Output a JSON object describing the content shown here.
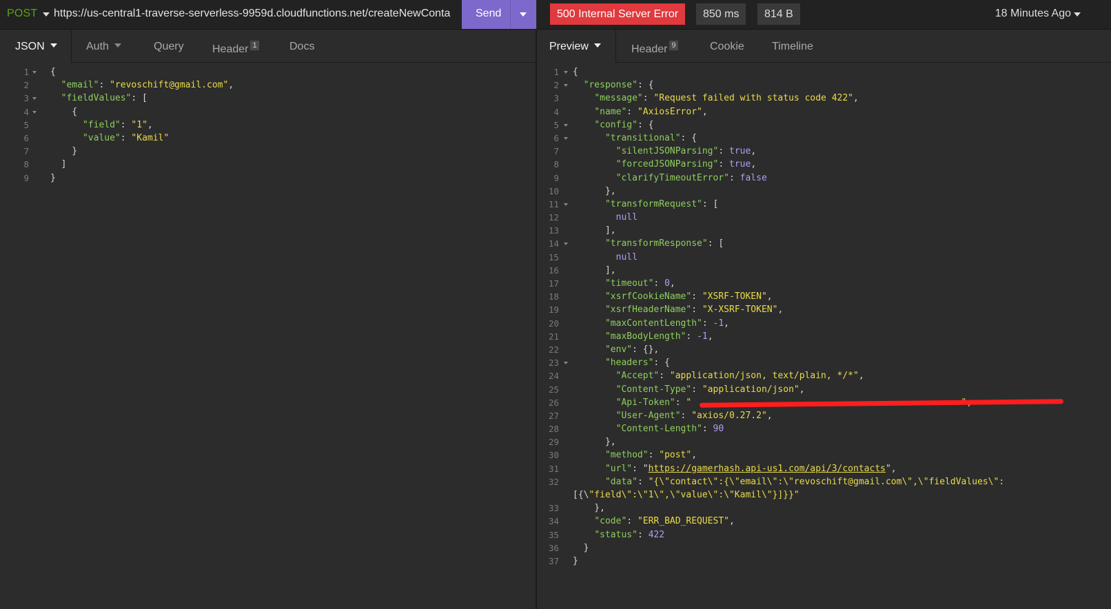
{
  "request": {
    "method": "POST",
    "url": "https://us-central1-traverse-serverless-9959d.cloudfunctions.net/createNewConta",
    "send_label": "Send"
  },
  "response_status": {
    "status": "500 Internal Server Error",
    "time": "850 ms",
    "size": "814 B",
    "ago": "18 Minutes Ago"
  },
  "request_tabs": [
    {
      "label": "JSON"
    },
    {
      "label": "Auth"
    },
    {
      "label": "Query"
    },
    {
      "label": "Header",
      "count": "1"
    },
    {
      "label": "Docs"
    }
  ],
  "response_tabs": [
    {
      "label": "Preview"
    },
    {
      "label": "Header",
      "count": "9"
    },
    {
      "label": "Cookie"
    },
    {
      "label": "Timeline"
    }
  ],
  "colors": {
    "send_button": "#7d69cb",
    "error_badge": "#e0393e",
    "json_key": "#8fcf5d",
    "json_string": "#eadb4b",
    "json_number": "#b39df3",
    "method": "#59a210"
  },
  "request_body": {
    "line_numbers": [
      "1",
      "2",
      "3",
      "4",
      "5",
      "6",
      "7",
      "8",
      "9"
    ],
    "lines": [
      "{",
      "  \"email\": \"revoschift@gmail.com\",",
      "  \"fieldValues\": [",
      "    {",
      "      \"field\": \"1\",",
      "      \"value\": \"Kamil\"",
      "    }",
      "  ]",
      "}"
    ]
  },
  "response_body": {
    "line_numbers": [
      "1",
      "2",
      "3",
      "4",
      "5",
      "6",
      "7",
      "8",
      "9",
      "10",
      "11",
      "12",
      "13",
      "14",
      "15",
      "16",
      "17",
      "18",
      "19",
      "20",
      "21",
      "22",
      "23",
      "24",
      "25",
      "26",
      "27",
      "28",
      "29",
      "30",
      "31",
      "32",
      "",
      "33",
      "34",
      "35",
      "36",
      "37"
    ],
    "lines": [
      "{",
      "  \"response\": {",
      "    \"message\": \"Request failed with status code 422\",",
      "    \"name\": \"AxiosError\",",
      "    \"config\": {",
      "      \"transitional\": {",
      "        \"silentJSONParsing\": true,",
      "        \"forcedJSONParsing\": true,",
      "        \"clarifyTimeoutError\": false",
      "      },",
      "      \"transformRequest\": [",
      "        null",
      "      ],",
      "      \"transformResponse\": [",
      "        null",
      "      ],",
      "      \"timeout\": 0,",
      "      \"xsrfCookieName\": \"XSRF-TOKEN\",",
      "      \"xsrfHeaderName\": \"X-XSRF-TOKEN\",",
      "      \"maxContentLength\": -1,",
      "      \"maxBodyLength\": -1,",
      "      \"env\": {},",
      "      \"headers\": {",
      "        \"Accept\": \"application/json, text/plain, */*\",",
      "        \"Content-Type\": \"application/json\",",
      "        \"Api-Token\": \"                                                  \",",
      "        \"User-Agent\": \"axios/0.27.2\",",
      "        \"Content-Length\": 90",
      "      },",
      "      \"method\": \"post\",",
      "      \"url\": \"https://gamerhash.api-us1.com/api/3/contacts\",",
      "      \"data\": \"{\\\"contact\\\":{\\\"email\\\":\\\"revoschift@gmail.com\\\",\\\"fieldValues\\\":",
      "[{\\\"field\\\":\\\"1\\\",\\\"value\\\":\\\"Kamil\\\"}]}}\"",
      "    },",
      "    \"code\": \"ERR_BAD_REQUEST\",",
      "    \"status\": 422",
      "  }",
      "}"
    ]
  }
}
